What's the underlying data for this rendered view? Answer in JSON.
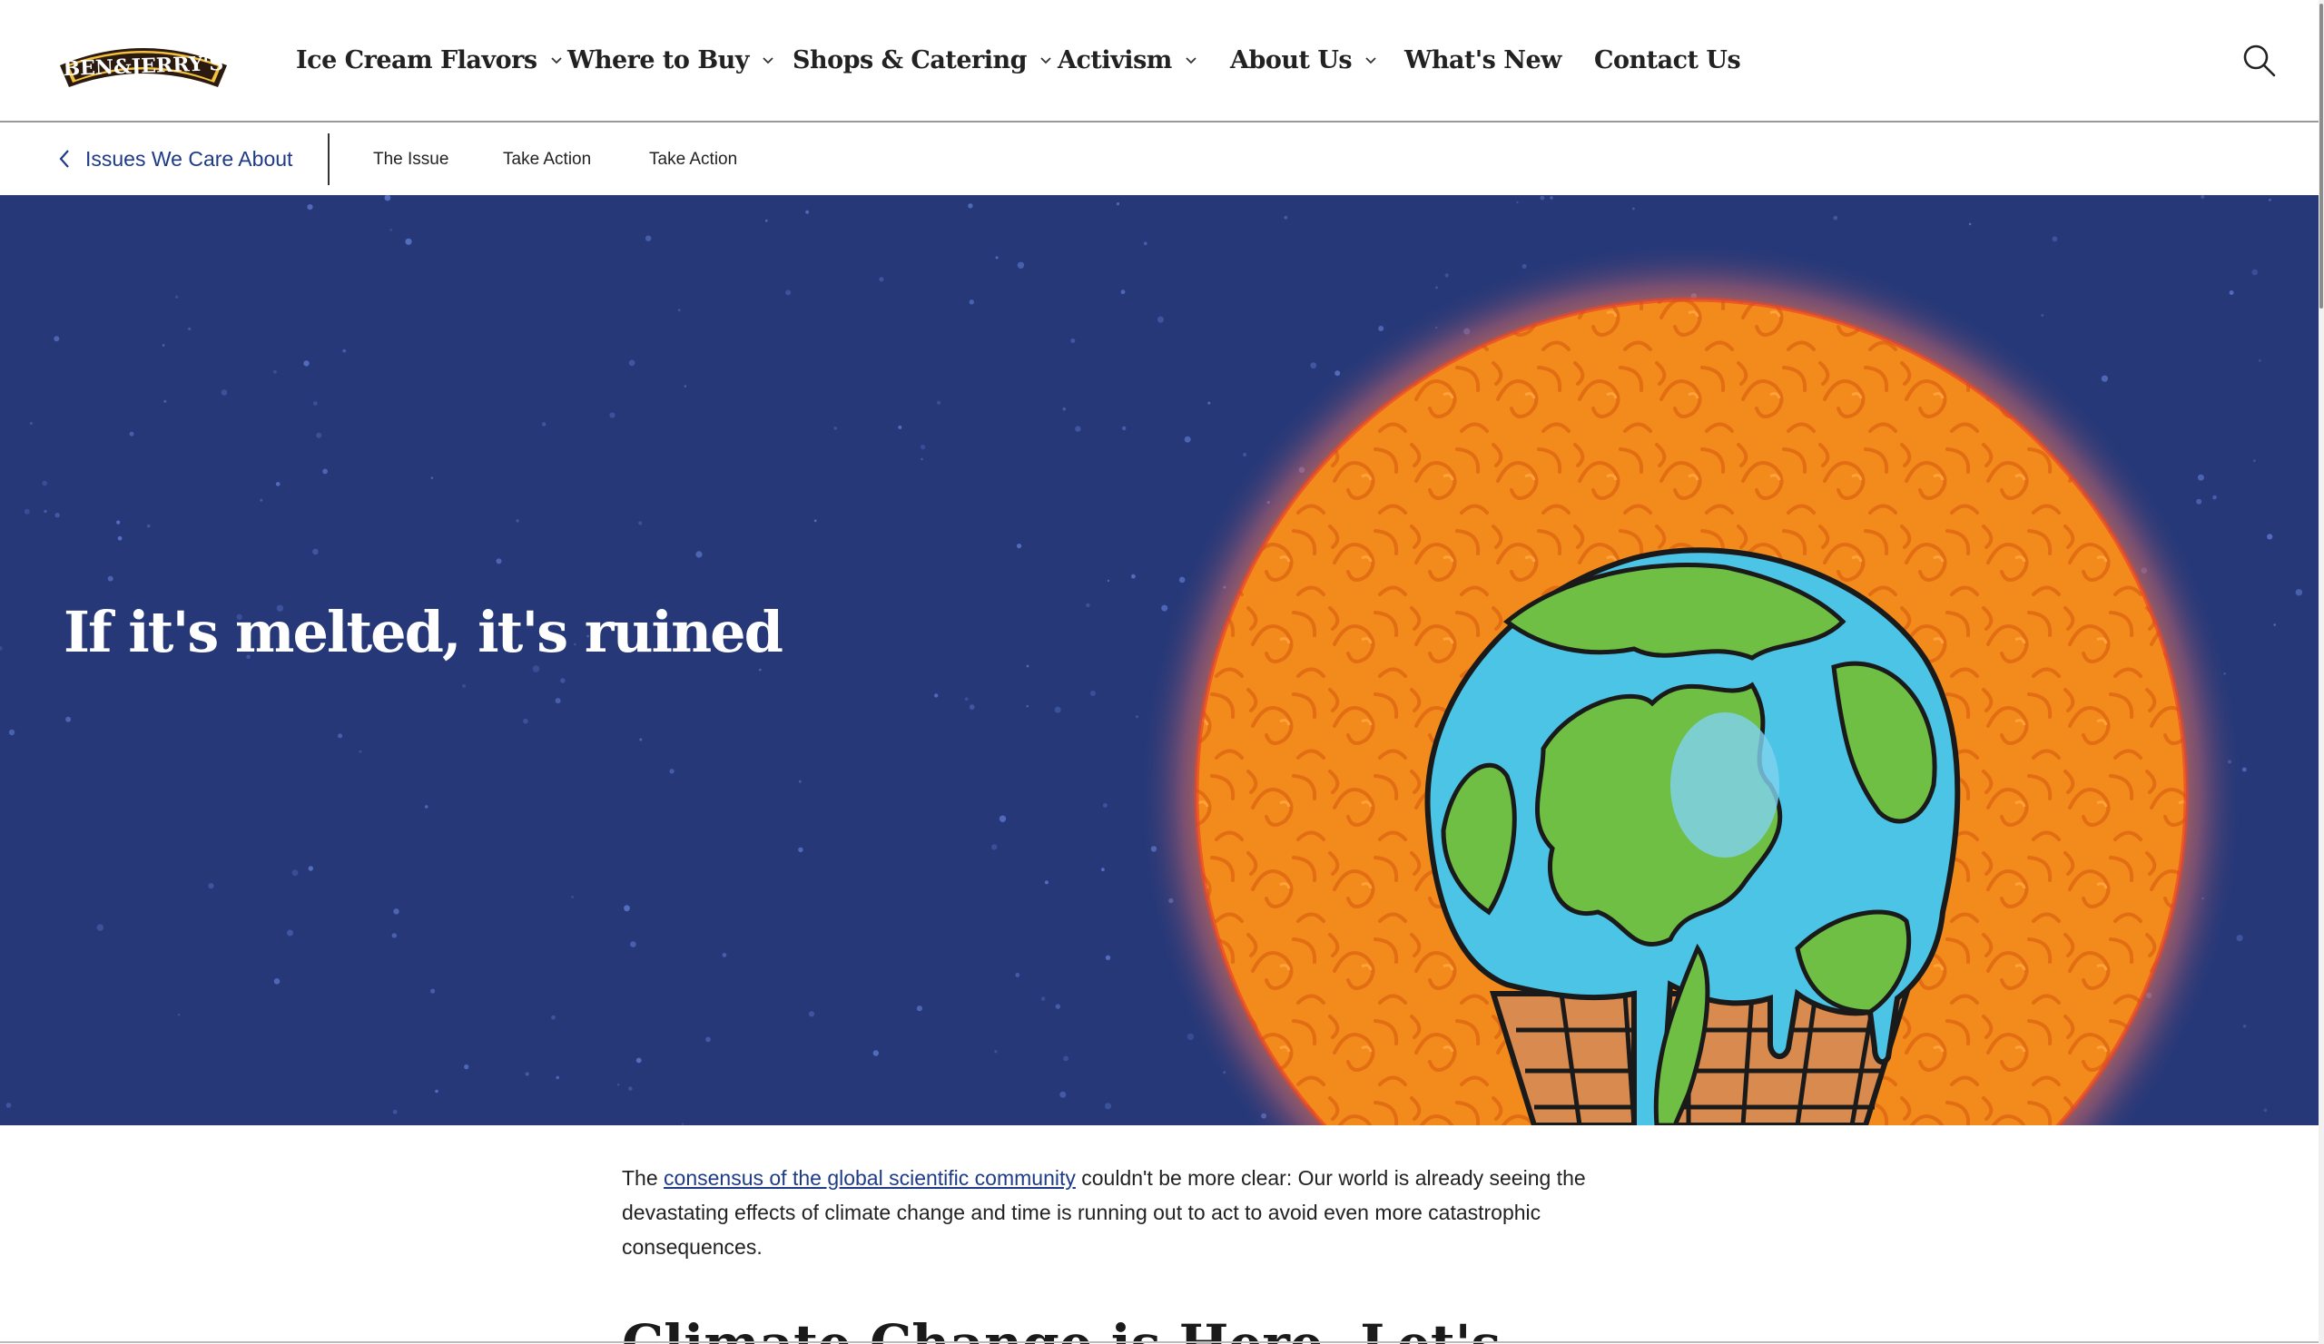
{
  "brand": {
    "logo_text": "BEN&JERRY'S"
  },
  "nav": {
    "items": [
      {
        "label": "Ice Cream Flavors",
        "has_dropdown": true
      },
      {
        "label": "Where to Buy",
        "has_dropdown": true
      },
      {
        "label": "Shops & Catering",
        "has_dropdown": true
      },
      {
        "label": "Activism",
        "has_dropdown": true
      },
      {
        "label": "About Us",
        "has_dropdown": true
      },
      {
        "label": "What's New",
        "has_dropdown": false
      },
      {
        "label": "Contact Us",
        "has_dropdown": false
      }
    ],
    "search_icon": "search-icon"
  },
  "subnav": {
    "back_label": "Issues We Care About",
    "tabs": [
      {
        "label": "The Issue"
      },
      {
        "label": "Take Action"
      },
      {
        "label": "Take Action"
      }
    ]
  },
  "hero": {
    "title": "If it's melted, it's ruined",
    "background_color": "#263878",
    "sun_color": "#f38a1c"
  },
  "intro": {
    "before_link": "The ",
    "link_text": "consensus of the global scientific community",
    "after_link": " couldn't be more clear: Our world is already seeing the devastating effects of climate change and time is running out to act to avoid even more catastrophic consequences."
  },
  "next_heading": "Climate Change is Here, Let's"
}
